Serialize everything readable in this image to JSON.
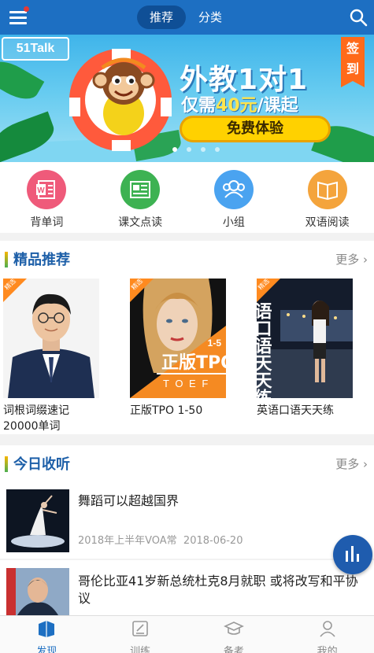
{
  "header": {
    "tabs": [
      {
        "label": "推荐",
        "active": true
      },
      {
        "label": "分类",
        "active": false
      }
    ],
    "menu_icon": "menu-icon",
    "search_icon": "search-icon",
    "accent": "#1d6fc2"
  },
  "banner": {
    "logo_text": "51Talk",
    "title": "外教1对1",
    "subtitle_prefix": "仅需",
    "subtitle_price": "40元",
    "subtitle_suffix": "/课起",
    "button": "免费体验",
    "sign_label": "签到",
    "slides": 4,
    "active_slide": 1
  },
  "quick_nav": [
    {
      "label": "背单词",
      "icon": "word-doc-icon",
      "color": "#ef5a7a"
    },
    {
      "label": "课文点读",
      "icon": "read-icon",
      "color": "#3db252"
    },
    {
      "label": "小组",
      "icon": "group-icon",
      "color": "#4aa3f0"
    },
    {
      "label": "双语阅读",
      "icon": "book-icon",
      "color": "#f4a43c"
    }
  ],
  "recommend": {
    "title": "精品推荐",
    "more": "更多",
    "items": [
      {
        "tag": "精选",
        "title": "词根词缀速记20000单词"
      },
      {
        "tag": "精选",
        "title": "正版TPO 1-50",
        "cover_text": "正版TPO",
        "cover_sub": "T O E F",
        "cover_num": "1-5"
      },
      {
        "tag": "精选",
        "title": "英语口语天天练",
        "cover_text": "语口语天天练"
      }
    ]
  },
  "listening": {
    "title": "今日收听",
    "more": "更多",
    "items": [
      {
        "title": "舞蹈可以超越国界",
        "source": "2018年上半年VOA常",
        "date": "2018-06-20"
      },
      {
        "title": "哥伦比亚41岁新总统杜克8月就职 或将改写和平协议"
      }
    ]
  },
  "bottom_nav": [
    {
      "label": "发现",
      "icon": "discover-icon",
      "active": true
    },
    {
      "label": "训练",
      "icon": "train-icon",
      "active": false
    },
    {
      "label": "备考",
      "icon": "exam-icon",
      "active": false
    },
    {
      "label": "我的",
      "icon": "profile-icon",
      "active": false
    }
  ]
}
